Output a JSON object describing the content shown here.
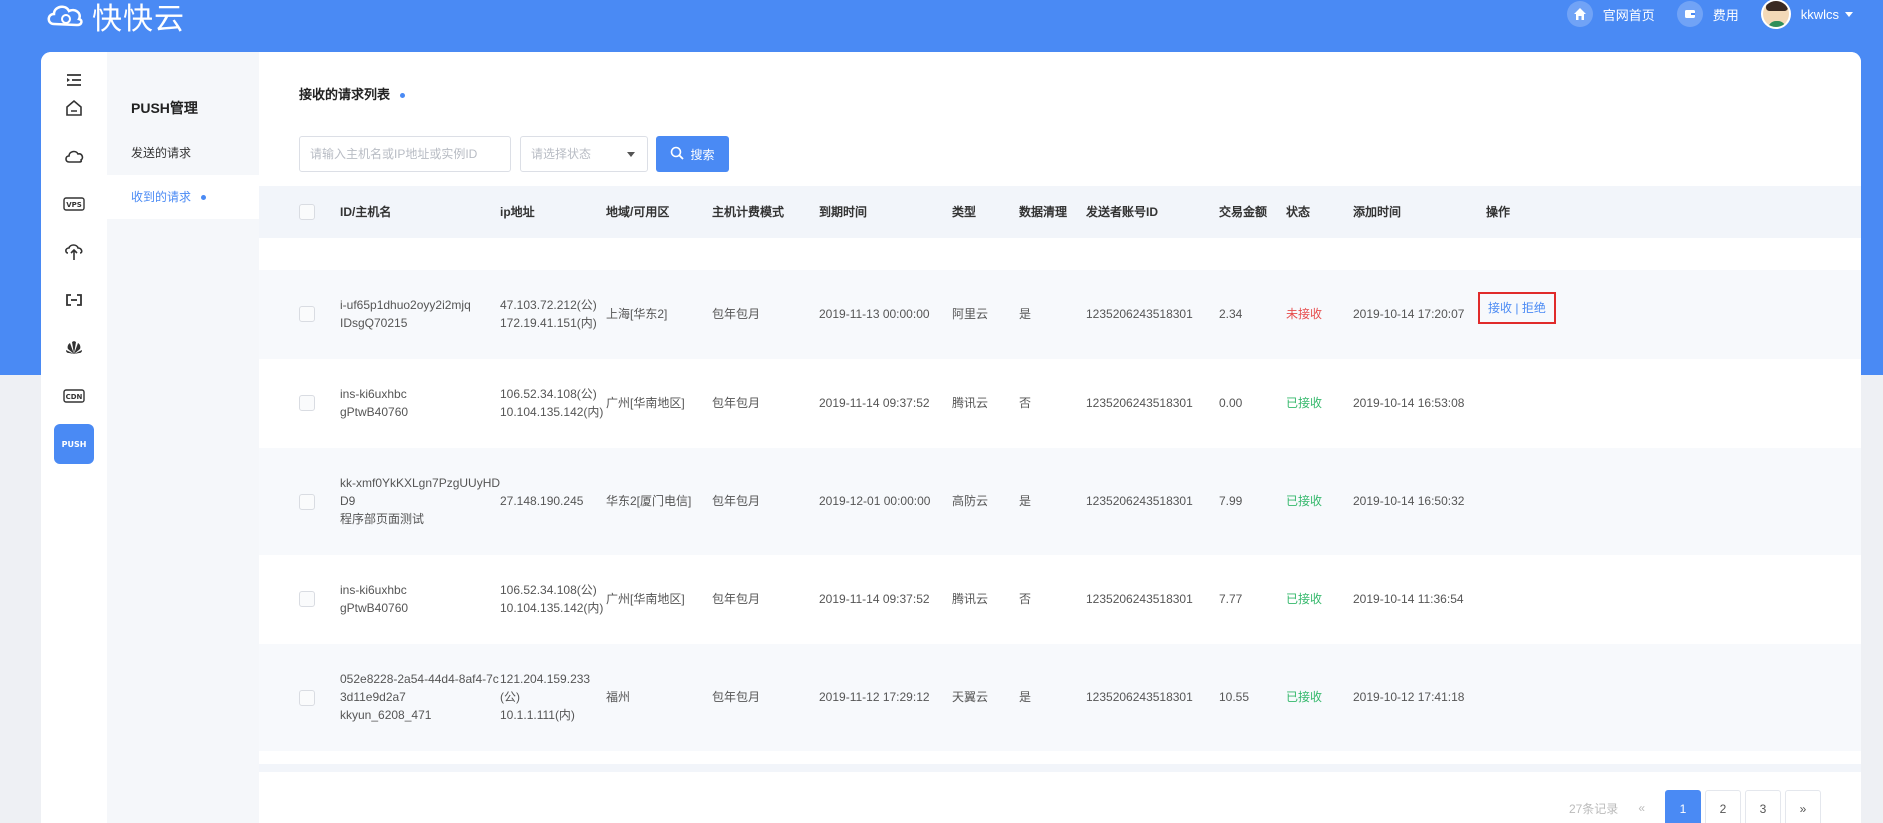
{
  "header": {
    "logo_text": "快快云",
    "links": [
      {
        "label": "官网首页",
        "icon": "home-icon"
      },
      {
        "label": "费用",
        "icon": "wallet-icon"
      }
    ],
    "user": {
      "name": "kkwlcs"
    }
  },
  "iconbar": {
    "items": [
      {
        "name": "collapse-menu-icon"
      },
      {
        "name": "home-icon"
      },
      {
        "name": "cloud-icon"
      },
      {
        "name": "vps-icon",
        "label": "VPS"
      },
      {
        "name": "cloud-upload-icon"
      },
      {
        "name": "link-icon"
      },
      {
        "name": "huawei-icon"
      },
      {
        "name": "cdn-icon",
        "label": "CDN"
      },
      {
        "name": "push-icon",
        "label": "PUSH",
        "active": true
      }
    ]
  },
  "submenu": {
    "title": "PUSH管理",
    "items": [
      {
        "label": "发送的请求",
        "active": false
      },
      {
        "label": "收到的请求",
        "active": true
      }
    ]
  },
  "main": {
    "title": "接收的请求列表",
    "search": {
      "placeholder": "请输入主机名或IP地址或实例ID",
      "value": ""
    },
    "status_select": {
      "placeholder": "请选择状态"
    },
    "search_button": "搜索",
    "table": {
      "columns": [
        "ID/主机名",
        "ip地址",
        "地域/可用区",
        "主机计费模式",
        "到期时间",
        "类型",
        "数据清理",
        "发送者账号ID",
        "交易金额",
        "状态",
        "添加时间",
        "操作"
      ],
      "rows": [
        {
          "id_lines": [
            "i-uf65p1dhuo2oyy2i2mjq",
            "IDsgQ70215"
          ],
          "ip_lines": [
            "47.103.72.212(公)",
            "172.19.41.151(内)"
          ],
          "region": "上海[华东2]",
          "billing": "包年包月",
          "expire": "2019-11-13 00:00:00",
          "type": "阿里云",
          "cleanup": "是",
          "sender": "1235206243518301",
          "amount": "2.34",
          "status": "未接收",
          "status_color": "#e74c4c",
          "added": "2019-10-14 17:20:07",
          "ops": {
            "accept": "接收",
            "sep": "|",
            "reject": "拒绝"
          }
        },
        {
          "id_lines": [
            "ins-ki6uxhbc",
            "gPtwB40760"
          ],
          "ip_lines": [
            "106.52.34.108(公)",
            "10.104.135.142(内)"
          ],
          "region": "广州[华南地区]",
          "billing": "包年包月",
          "expire": "2019-11-14 09:37:52",
          "type": "腾讯云",
          "cleanup": "否",
          "sender": "1235206243518301",
          "amount": "0.00",
          "status": "已接收",
          "status_color": "#34b86b",
          "added": "2019-10-14 16:53:08"
        },
        {
          "id_lines": [
            "kk-xmf0YkKXLgn7PzgUUyHD",
            "D9",
            "程序部页面测试"
          ],
          "ip_lines": [
            "27.148.190.245"
          ],
          "region": "华东2[厦门电信]",
          "billing": "包年包月",
          "expire": "2019-12-01 00:00:00",
          "type": "高防云",
          "cleanup": "是",
          "sender": "1235206243518301",
          "amount": "7.99",
          "status": "已接收",
          "status_color": "#34b86b",
          "added": "2019-10-14 16:50:32"
        },
        {
          "id_lines": [
            "ins-ki6uxhbc",
            "gPtwB40760"
          ],
          "ip_lines": [
            "106.52.34.108(公)",
            "10.104.135.142(内)"
          ],
          "region": "广州[华南地区]",
          "billing": "包年包月",
          "expire": "2019-11-14 09:37:52",
          "type": "腾讯云",
          "cleanup": "否",
          "sender": "1235206243518301",
          "amount": "7.77",
          "status": "已接收",
          "status_color": "#34b86b",
          "added": "2019-10-14 11:36:54"
        },
        {
          "id_lines": [
            "052e8228-2a54-44d4-8af4-7c",
            "3d11e9d2a7",
            "kkyun_6208_471"
          ],
          "ip_lines": [
            "121.204.159.233",
            "(公)",
            "10.1.1.111(内)"
          ],
          "region": "福州",
          "billing": "包年包月",
          "expire": "2019-11-12 17:29:12",
          "type": "天翼云",
          "cleanup": "是",
          "sender": "1235206243518301",
          "amount": "10.55",
          "status": "已接收",
          "status_color": "#34b86b",
          "added": "2019-10-12 17:41:18"
        }
      ]
    },
    "pagination": {
      "total": "27条记录",
      "prev": "«",
      "pages": [
        "1",
        "2",
        "3"
      ],
      "current": "1",
      "next": "»"
    }
  },
  "colors": {
    "accent": "#4a8af4",
    "danger": "#e74c4c",
    "success": "#34b86b",
    "highlight_border": "#e02b2b"
  }
}
